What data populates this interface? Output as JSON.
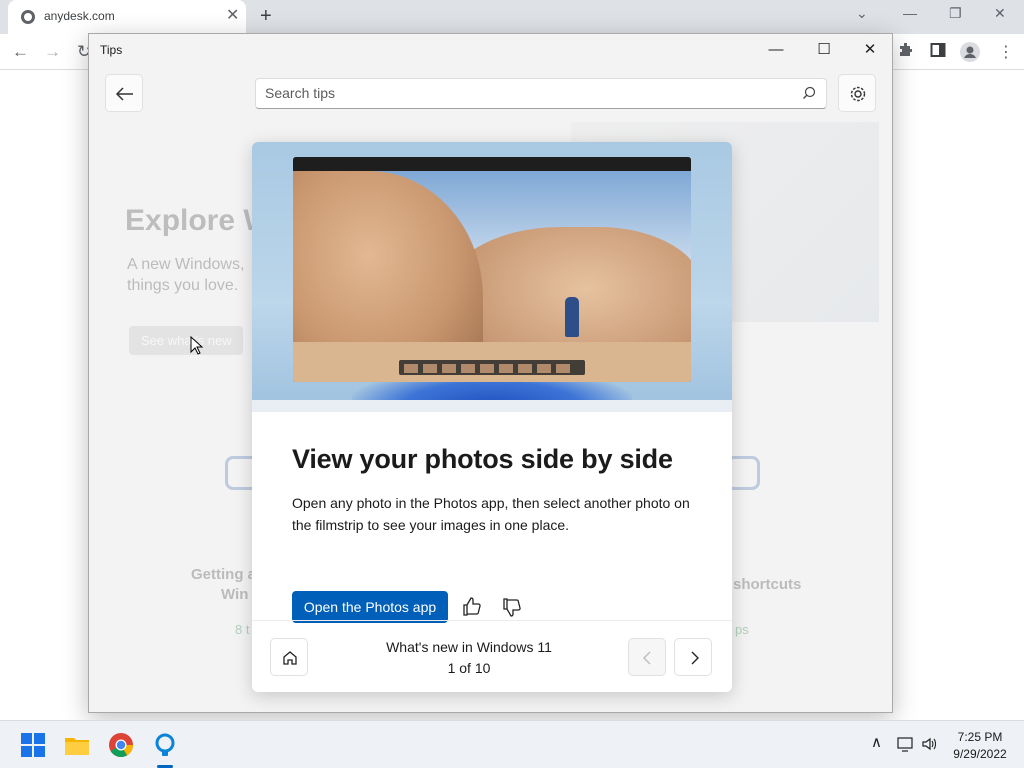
{
  "browser": {
    "tab_title": "anydesk.com",
    "tab_close": "✕",
    "new_tab": "+",
    "back": "←",
    "forward": "→"
  },
  "window": {
    "title": "Tips",
    "minimize": "—",
    "maximize": "☐",
    "close": "✕"
  },
  "search": {
    "placeholder": "Search tips"
  },
  "background_page": {
    "hero_heading": "Explore W",
    "hero_text": "A new Windows, things you love.",
    "hero_button": "See what's new",
    "card_left_label_1": "Getting a",
    "card_left_label_2": "Win",
    "card_left_sub": "8 t",
    "card_right_label": "shortcuts",
    "card_right_sub": "ps"
  },
  "tip": {
    "heading": "View your photos side by side",
    "body": "Open any photo in the Photos app, then select another photo on the filmstrip to see your images in one place.",
    "primary_button": "Open the Photos app",
    "collection_title": "What's new in Windows 11",
    "position": "1 of 10"
  },
  "taskbar": {
    "time": "7:25 PM",
    "date": "9/29/2022",
    "tray_chevron": "∧"
  },
  "colors": {
    "accent": "#005fb8",
    "window_bg": "#f3f3f3"
  }
}
